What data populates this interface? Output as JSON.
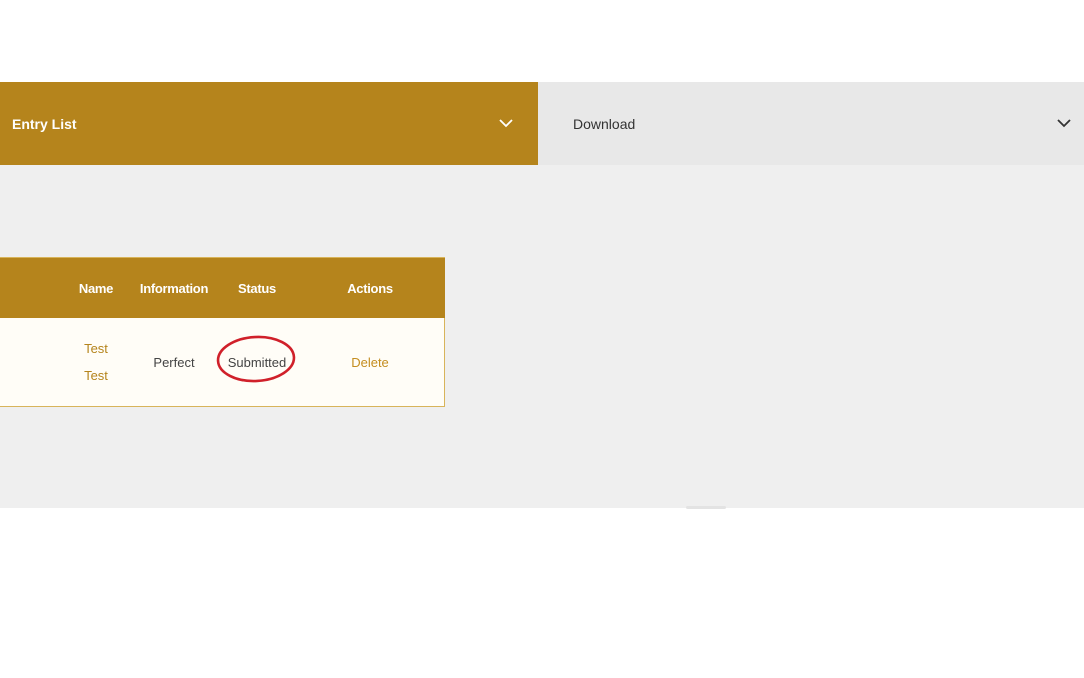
{
  "tabs": {
    "entry_list": "Entry List",
    "download": "Download"
  },
  "table": {
    "headers": {
      "name": "Name",
      "information": "Information",
      "status": "Status",
      "actions": "Actions"
    },
    "rows": [
      {
        "name_line1": "Test",
        "name_line2": "Test",
        "information": "Perfect",
        "status": "Submitted",
        "action": "Delete"
      }
    ]
  },
  "colors": {
    "accent": "#b5841c",
    "highlight_circle": "#d0202a"
  },
  "icons": {
    "tab_chevron": "chevron-down-icon"
  }
}
